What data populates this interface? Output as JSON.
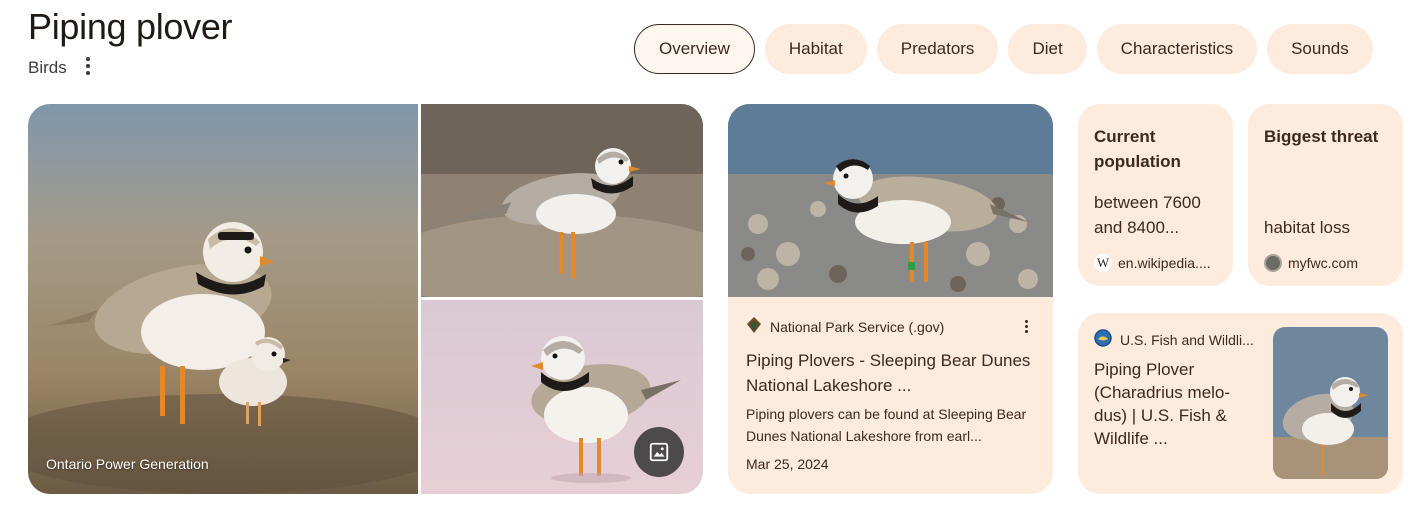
{
  "header": {
    "title": "Piping plover",
    "subtitle": "Birds"
  },
  "tabs": [
    {
      "label": "Overview",
      "active": true
    },
    {
      "label": "Habitat",
      "active": false
    },
    {
      "label": "Predators",
      "active": false
    },
    {
      "label": "Diet",
      "active": false
    },
    {
      "label": "Characteristics",
      "active": false
    },
    {
      "label": "Sounds",
      "active": false
    }
  ],
  "gallery": {
    "main_caption": "Ontario Power Generation",
    "image_button_icon": "image-icon"
  },
  "nps_card": {
    "source": "National Park Service (.gov)",
    "source_icon": "nps-arrowhead-icon",
    "title": "Piping Plovers - Sleeping Bear Dunes National Lakeshore ...",
    "snippet": "Piping plovers can be found at Sleeping Bear Dunes National Lakeshore from earl...",
    "date": "Mar 25, 2024"
  },
  "population_card": {
    "title": "Current population",
    "value": "between 7600 and 8400...",
    "source": "en.wikipedia....",
    "source_icon": "wikipedia-icon"
  },
  "threat_card": {
    "title": "Biggest threat",
    "value": "habitat loss",
    "source": "myfwc.com",
    "source_icon": "myfwc-icon"
  },
  "usfws_card": {
    "source": "U.S. Fish and Wildli...",
    "source_icon": "usfws-icon",
    "title": "Piping Plover (Charadrius melo-dus) | U.S. Fish & Wildlife ..."
  },
  "colors": {
    "chip_bg": "#fdebdd",
    "card_bg": "#fdebdd",
    "text": "#3a2a20"
  }
}
